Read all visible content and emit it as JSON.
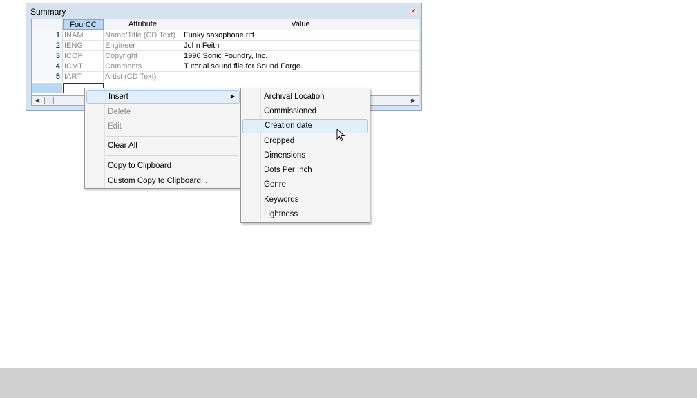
{
  "summary": {
    "title": "Summary",
    "close_glyph": "✕",
    "columns": [
      "FourCC",
      "Attribute",
      "Value"
    ],
    "rows": [
      {
        "num": "1",
        "fourcc": "INAM",
        "attribute": "Name/Title (CD Text)",
        "value": "Funky saxophone riff"
      },
      {
        "num": "2",
        "fourcc": "IENG",
        "attribute": "Engineer",
        "value": "John Feith"
      },
      {
        "num": "3",
        "fourcc": "ICOP",
        "attribute": "Copyright",
        "value": "1996 Sonic Foundry, Inc."
      },
      {
        "num": "4",
        "fourcc": "ICMT",
        "attribute": "Comments",
        "value": "Tutorial sound file for Sound Forge."
      },
      {
        "num": "5",
        "fourcc": "IART",
        "attribute": "Artist (CD Text)",
        "value": ""
      }
    ],
    "scroll_left": "◀",
    "scroll_right": "▶"
  },
  "context_menu": {
    "items": [
      {
        "label": "Insert",
        "disabled": false,
        "submenu": true
      },
      {
        "label": "Delete",
        "disabled": true
      },
      {
        "label": "Edit",
        "disabled": true
      },
      {
        "label": "Clear All",
        "disabled": false
      },
      {
        "label": "Copy to Clipboard",
        "disabled": false
      },
      {
        "label": "Custom Copy to Clipboard...",
        "disabled": false
      }
    ],
    "submenu_arrow": "▶"
  },
  "insert_submenu": {
    "items": [
      "Archival Location",
      "Commissioned",
      "Creation date",
      "Cropped",
      "Dimensions",
      "Dots Per Inch",
      "Genre",
      "Keywords",
      "Lightness"
    ],
    "highlighted": "Creation date"
  },
  "colors": {
    "window_bg": "#d6e2f0",
    "header_selected": "#b9d8f4",
    "menu_highlight": "#e2eef8",
    "footer": "#cfcfcf"
  },
  "icons": {
    "close": "close-icon",
    "cursor": "mouse-pointer-icon",
    "submenu": "chevron-right-icon"
  }
}
